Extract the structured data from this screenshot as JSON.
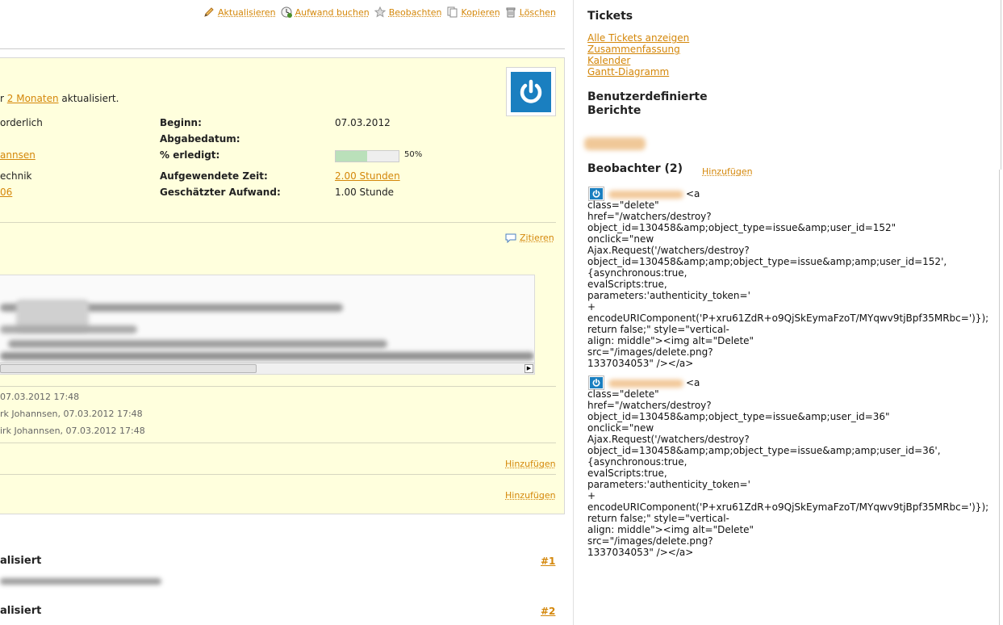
{
  "toolbar": {
    "update_label": "Aktualisieren",
    "log_time_label": "Aufwand buchen",
    "watch_label": "Beobachten",
    "copy_label": "Kopieren",
    "delete_label": "Löschen"
  },
  "issue": {
    "updated_prefix": "r",
    "updated_link": "2 Monaten",
    "updated_suffix": "aktualisiert.",
    "left_col": {
      "priority_fragment": "orderlich",
      "assignee_fragment": "annsen",
      "category_fragment": "echnik",
      "version_fragment": "06"
    },
    "fields": {
      "start_label": "Beginn:",
      "start_value": "07.03.2012",
      "due_label": "Abgabedatum:",
      "done_label": "% erledigt:",
      "done_value": "50%",
      "done_fraction": 0.5,
      "spent_label": "Aufgewendete Zeit:",
      "spent_value": "2.00 Stunden",
      "estimated_label": "Geschätzter Aufwand:",
      "estimated_value": "1.00 Stunde"
    },
    "quote_label": "Zitieren",
    "attachments": [
      "07.03.2012 17:48",
      "rk Johannsen, 07.03.2012 17:48",
      "irk Johannsen, 07.03.2012 17:48"
    ],
    "add_subtask_label": "Hinzufügen",
    "add_relation_label": "Hinzufügen"
  },
  "history": [
    {
      "title": "alisiert",
      "num": "#1"
    },
    {
      "title": "alisiert",
      "num": "#2"
    }
  ],
  "sidebar": {
    "tickets_heading": "Tickets",
    "links": [
      "Alle Tickets anzeigen",
      "Zusammenfassung",
      "Kalender",
      "Gantt-Diagramm"
    ],
    "custom_reports_heading_1": "Benutzerdefinierte",
    "custom_reports_heading_2": "Berichte",
    "watchers_heading": "Beobachter (2)",
    "watchers_add_label": "Hinzufügen",
    "watcher_raw_1": "<a\nclass=\"delete\"\nhref=\"/watchers/destroy?\nobject_id=130458&amp;object_type=issue&amp;user_id=152\"\nonclick=\"new\nAjax.Request('/watchers/destroy?\nobject_id=130458&amp;amp;object_type=issue&amp;amp;user_id=152',\n{asynchronous:true,\nevalScripts:true,\nparameters:'authenticity_token='\n+\nencodeURIComponent('P+xru61ZdR+o9QjSkEymaFzoT/MYqwv9tjBpf35MRbc=')});\nreturn false;\" style=\"vertical-\nalign: middle\"><img alt=\"Delete\"\nsrc=\"/images/delete.png?\n1337034053\" /></a>",
    "watcher_raw_2": "<a\nclass=\"delete\"\nhref=\"/watchers/destroy?\nobject_id=130458&amp;object_type=issue&amp;user_id=36\"\nonclick=\"new\nAjax.Request('/watchers/destroy?\nobject_id=130458&amp;amp;object_type=issue&amp;amp;user_id=36',\n{asynchronous:true,\nevalScripts:true,\nparameters:'authenticity_token='\n+\nencodeURIComponent('P+xru61ZdR+o9QjSkEymaFzoT/MYqwv9tjBpf35MRbc=')});\nreturn false;\" style=\"vertical-\nalign: middle\"><img alt=\"Delete\"\nsrc=\"/images/delete.png?\n1337034053\" /></a>"
  },
  "colors": {
    "link": "#d4870a",
    "issue_bg": "#ffffdd",
    "avatar_blue": "#1a7fc0",
    "progress_fill": "#bae0ba"
  },
  "icons": [
    "edit-icon",
    "time-icon",
    "star-icon",
    "copy-icon",
    "trash-icon",
    "comment-icon",
    "power-icon"
  ]
}
